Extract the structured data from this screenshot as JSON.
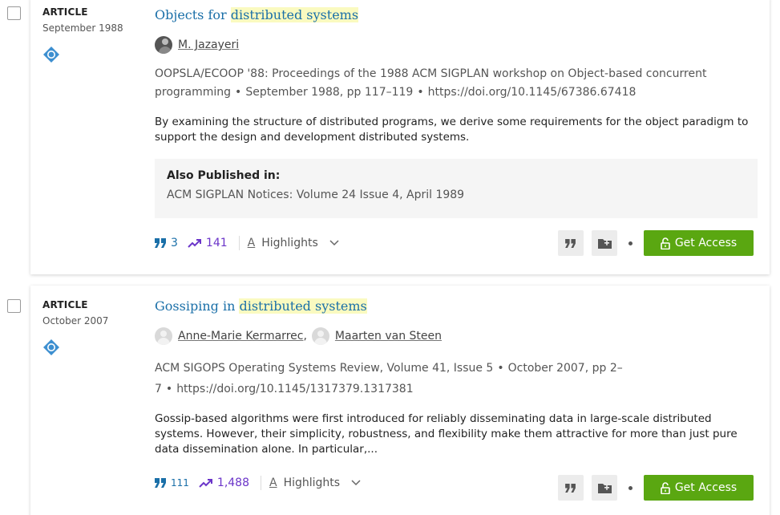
{
  "results": [
    {
      "type": "ARTICLE",
      "date": "September 1988",
      "title_pre": "Objects for ",
      "title_hl": "distributed systems",
      "title_post": "",
      "authors": [
        {
          "name": "M. Jazayeri",
          "sep": ""
        }
      ],
      "venue": "OOPSLA/ECOOP '88: Proceedings of the 1988 ACM SIGPLAN workshop on Object-based concurrent programming",
      "date_pages": "September 1988, pp 117–119",
      "doi": "https://doi.org/10.1145/67386.67418",
      "abstract": "By examining the structure of distributed programs, we derive some requirements for the object paradigm to support the design and development distributed systems.",
      "also_title": "Also Published in:",
      "also_text": "ACM SIGPLAN Notices: Volume 24 Issue 4, April 1989",
      "citations": "3",
      "downloads": "141",
      "highlights_label": "Highlights",
      "access_label": "Get Access"
    },
    {
      "type": "ARTICLE",
      "date": "October 2007",
      "title_pre": "Gossiping in ",
      "title_hl": "distributed systems",
      "title_post": "",
      "authors": [
        {
          "name": "Anne-Marie Kermarrec",
          "sep": ","
        },
        {
          "name": "Maarten van Steen",
          "sep": ""
        }
      ],
      "venue_line1": "ACM SIGOPS Operating Systems Review, Volume 41, Issue 5",
      "venue_line1_b": "October 2007, pp 2–",
      "venue_line2": "7",
      "doi": "https://doi.org/10.1145/1317379.1317381",
      "abstract": "Gossip-based algorithms were first introduced for reliably disseminating data in large-scale distributed systems. However, their simplicity, robustness, and flexibility make them attractive for more than just pure data dissemination alone. In particular,...",
      "citations": "111",
      "downloads": "1,488",
      "highlights_label": "Highlights",
      "access_label": "Get Access"
    }
  ],
  "colors": {
    "link": "#1a6fa8",
    "highlight": "#fafac0",
    "downloads": "#6b35c9",
    "access_button": "#5aa711"
  },
  "icons": {
    "publisher": "acm-diamond-icon",
    "citations": "quote-icon",
    "downloads": "trending-up-icon",
    "highlights": "text-a-icon",
    "expand": "chevron-down-icon",
    "cite_button": "quote-icon",
    "save_button": "folder-add-icon",
    "access": "lock-open-icon"
  }
}
